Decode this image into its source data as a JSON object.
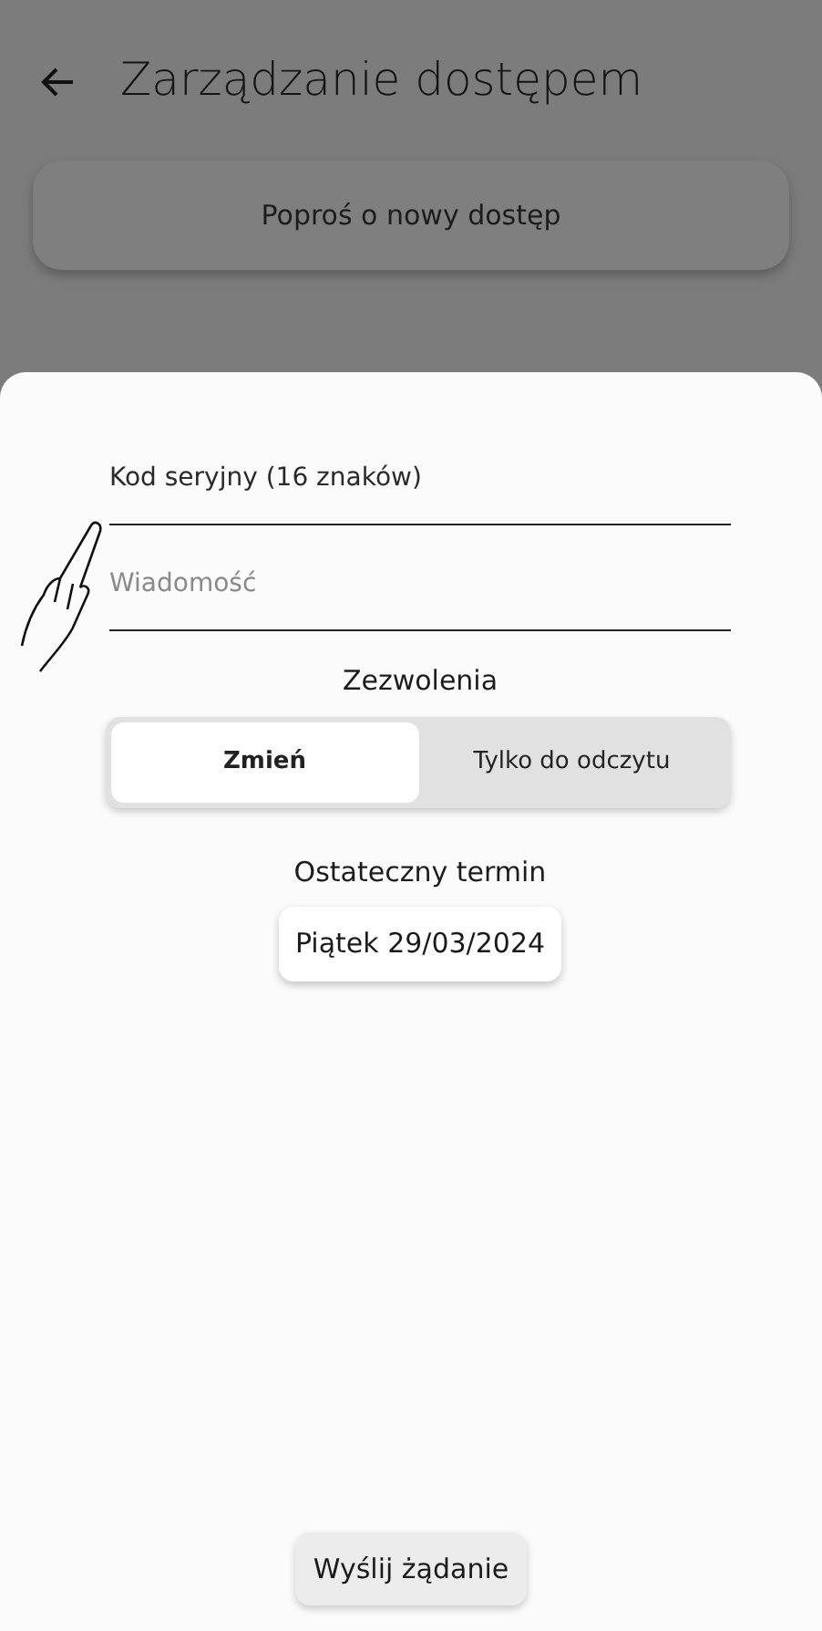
{
  "app_bar": {
    "title": "Zarządzanie dostępem"
  },
  "request_button": {
    "label": "Poproś o nowy dostęp"
  },
  "sheet": {
    "fields": [
      {
        "placeholder": "Kod seryjny (16 znaków)"
      },
      {
        "placeholder": "Wiadomość"
      }
    ],
    "permissions": {
      "label": "Zezwolenia",
      "options": [
        {
          "label": "Zmień",
          "selected": true
        },
        {
          "label": "Tylko do odczytu",
          "selected": false
        }
      ]
    },
    "deadline": {
      "label": "Ostateczny termin",
      "value": "Piątek 29/03/2024"
    },
    "submit": {
      "label": "Wyślij żądanie"
    }
  }
}
